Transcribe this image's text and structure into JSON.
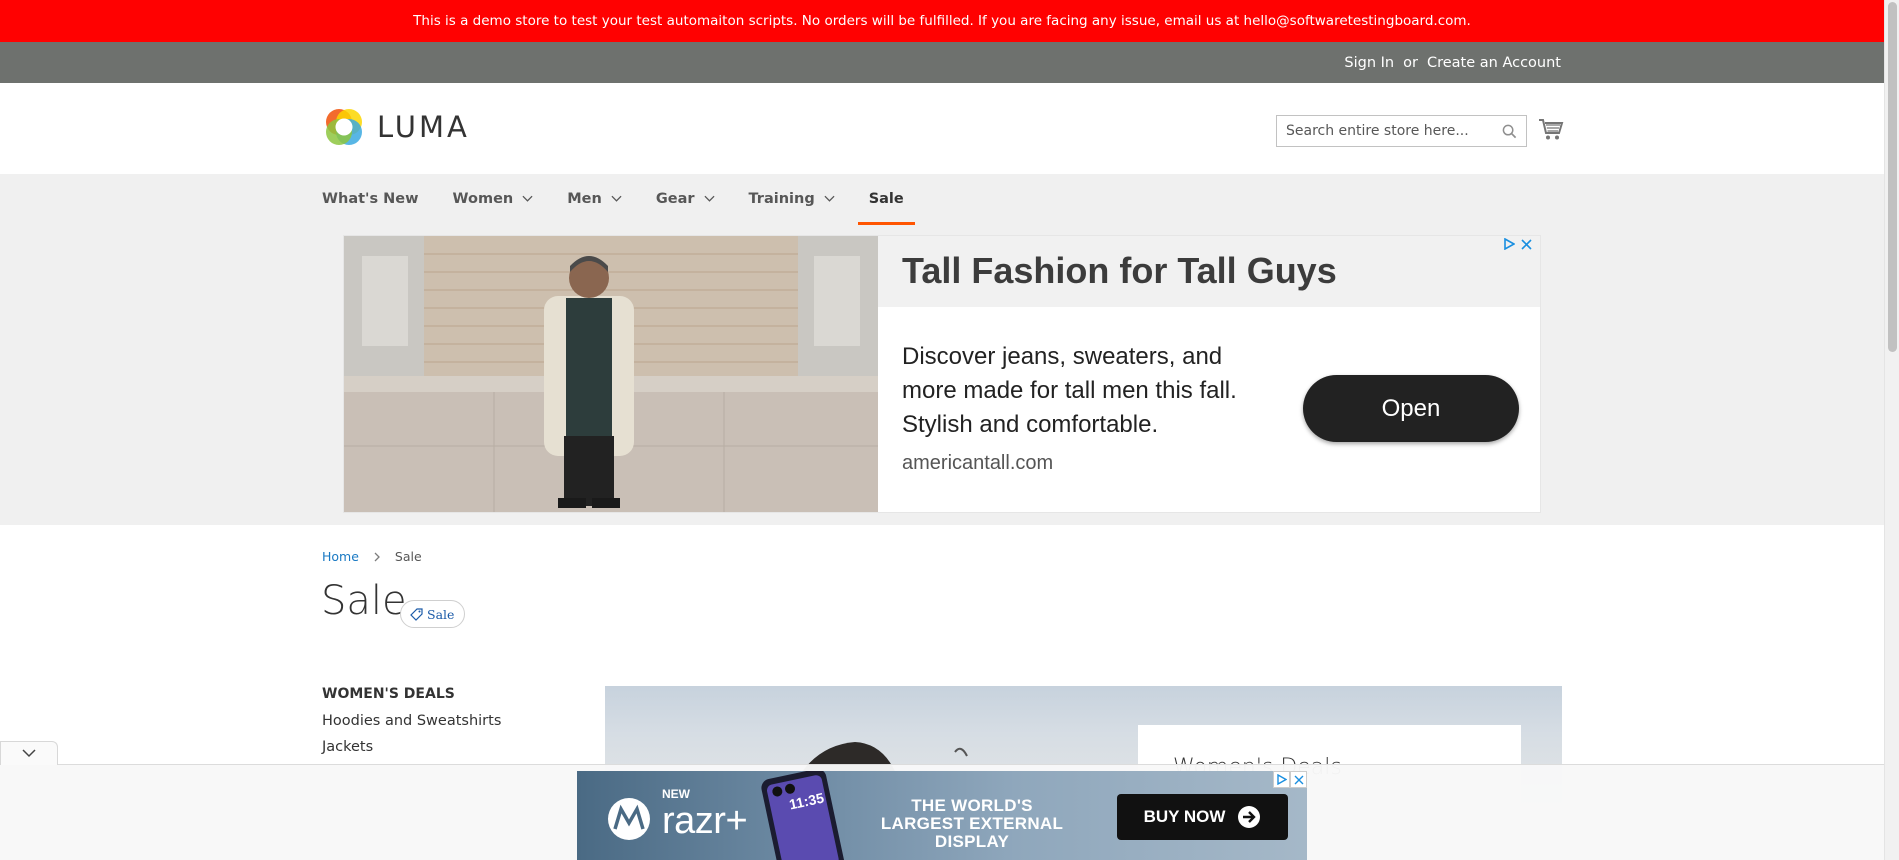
{
  "demo_notice": "This is a demo store to test your test automaiton scripts. No orders will be fulfilled. If you are facing any issue, email us at hello@softwaretestingboard.com.",
  "header": {
    "sign_in": "Sign In",
    "or": "or",
    "create_account": "Create an Account",
    "logo_text": "LUMA",
    "search_placeholder": "Search entire store here..."
  },
  "nav": {
    "items": [
      {
        "label": "What's New",
        "has_dropdown": false
      },
      {
        "label": "Women",
        "has_dropdown": true
      },
      {
        "label": "Men",
        "has_dropdown": true
      },
      {
        "label": "Gear",
        "has_dropdown": true
      },
      {
        "label": "Training",
        "has_dropdown": true
      },
      {
        "label": "Sale",
        "has_dropdown": false,
        "active": true
      }
    ]
  },
  "ad_top": {
    "headline": "Tall Fashion for Tall Guys",
    "body": "Discover jeans, sweaters, and more made for tall men this fall. Stylish and comfortable.",
    "domain": "americantall.com",
    "cta": "Open"
  },
  "breadcrumbs": {
    "home": "Home",
    "current": "Sale"
  },
  "page": {
    "title": "Sale",
    "badge": "Sale"
  },
  "sidebar": {
    "heading": "WOMEN'S DEALS",
    "links": [
      "Hoodies and Sweatshirts",
      "Jackets"
    ]
  },
  "promo": {
    "card_title": "Women's Deals"
  },
  "sticky_ad": {
    "new_label": "NEW",
    "product": "razr+",
    "phone_time": "11:35",
    "tagline": "THE WORLD'S LARGEST EXTERNAL DISPLAY",
    "cta": "BUY NOW"
  },
  "colors": {
    "notice_bg": "#ff0101",
    "header_panel_bg": "#6e716e",
    "nav_active_underline": "#ff5501",
    "link_blue": "#1979c3"
  }
}
